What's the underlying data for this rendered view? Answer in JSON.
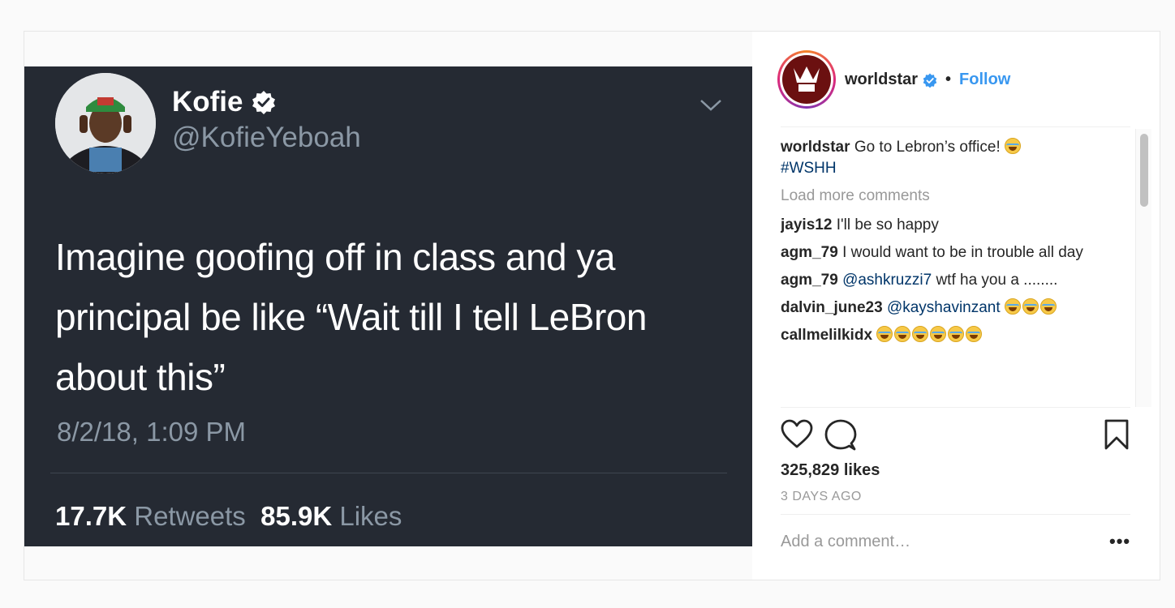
{
  "tweet": {
    "name": "Kofie",
    "handle": "@KofieYeboah",
    "text": "Imagine goofing off in class and ya principal be like “Wait till I tell LeBron about this”",
    "timestamp": "8/2/18, 1:09 PM",
    "retweets_count": "17.7K",
    "retweets_label": "Retweets",
    "likes_count": "85.9K",
    "likes_label": "Likes"
  },
  "header": {
    "username": "worldstar",
    "separator": "•",
    "follow_label": "Follow"
  },
  "caption": {
    "user": "worldstar",
    "text": "Go to Lebron’s office!",
    "hashtag": "#WSHH"
  },
  "load_more_label": "Load more comments",
  "comments": [
    {
      "user": "jayis12",
      "text": "I'll be so happy"
    },
    {
      "user": "agm_79",
      "text": "I would want to be in trouble all day"
    },
    {
      "user": "agm_79",
      "mention": "@ashkruzzi7",
      "text": "wtf ha you a ........"
    },
    {
      "user": "dalvin_june23",
      "mention": "@kayshavinzant",
      "emoji_count": 3
    },
    {
      "user": "callmelilkidx",
      "emoji_count": 6
    }
  ],
  "likes_text": "325,829 likes",
  "time_ago": "3 DAYS AGO",
  "add_comment_placeholder": "Add a comment…",
  "more_options": "•••",
  "colors": {
    "tweet_bg": "#252a33",
    "link_blue": "#3897f0",
    "tag_blue": "#003569",
    "muted_gray": "#999999"
  },
  "icons": [
    "verified-badge-icon",
    "chevron-down-icon",
    "heart-icon",
    "comment-icon",
    "bookmark-icon",
    "face-with-tears-of-joy-emoji"
  ]
}
